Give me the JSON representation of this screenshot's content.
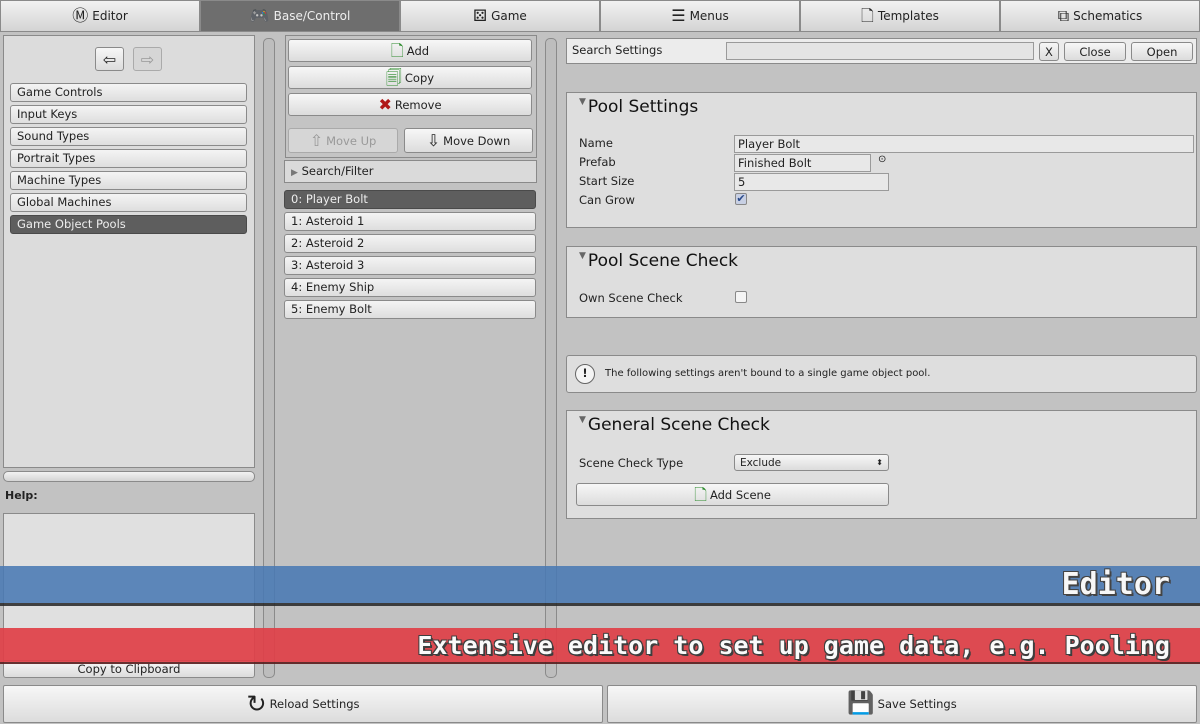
{
  "tabs": [
    {
      "label": "Editor",
      "icon": "editor-logo-icon",
      "glyph": "Ⓜ"
    },
    {
      "label": "Base/Control",
      "icon": "gamepad-icon",
      "glyph": "🎮",
      "active": true
    },
    {
      "label": "Game",
      "icon": "dice-icon",
      "glyph": "⚄"
    },
    {
      "label": "Menus",
      "icon": "menu-list-icon",
      "glyph": "☰"
    },
    {
      "label": "Templates",
      "icon": "document-icon",
      "glyph": "🗋"
    },
    {
      "label": "Schematics",
      "icon": "schematic-icon",
      "glyph": "⧉"
    }
  ],
  "left": {
    "back_glyph": "⇦",
    "forward_glyph": "⇨",
    "items": [
      "Game Controls",
      "Input Keys",
      "Sound Types",
      "Portrait Types",
      "Machine Types",
      "Global Machines",
      "Game Object Pools"
    ],
    "selected": 6,
    "help_label": "Help:",
    "copy_label": "Copy to Clipboard"
  },
  "middle": {
    "add": "Add",
    "copy": "Copy",
    "remove": "Remove",
    "move_up": "Move Up",
    "move_down": "Move Down",
    "search_filter": "Search/Filter",
    "items": [
      "0: Player Bolt",
      "1: Asteroid 1",
      "2: Asteroid 2",
      "3: Asteroid 3",
      "4: Enemy Ship",
      "5: Enemy Bolt"
    ],
    "selected": 0
  },
  "right": {
    "search": {
      "label": "Search Settings",
      "value": "",
      "clear": "X",
      "close": "Close",
      "open": "Open"
    },
    "pool_settings": {
      "title": "Pool Settings",
      "name_label": "Name",
      "name_value": "Player Bolt",
      "prefab_label": "Prefab",
      "prefab_value": "Finished Bolt",
      "start_size_label": "Start Size",
      "start_size_value": "5",
      "can_grow_label": "Can Grow",
      "can_grow": true
    },
    "pool_scene_check": {
      "title": "Pool Scene Check",
      "own_label": "Own Scene Check",
      "own": false
    },
    "info": "The following settings aren't bound to a single game object pool.",
    "general": {
      "title": "General Scene Check",
      "type_label": "Scene Check Type",
      "type_value": "Exclude",
      "add_scene": "Add Scene"
    }
  },
  "bottom": {
    "reload": "Reload Settings",
    "save": "Save Settings"
  },
  "overlay": {
    "title": "Editor",
    "subtitle": "Extensive editor to set up game data, e.g. Pooling",
    "blue": "#4a7ab4",
    "red": "#e04048"
  }
}
